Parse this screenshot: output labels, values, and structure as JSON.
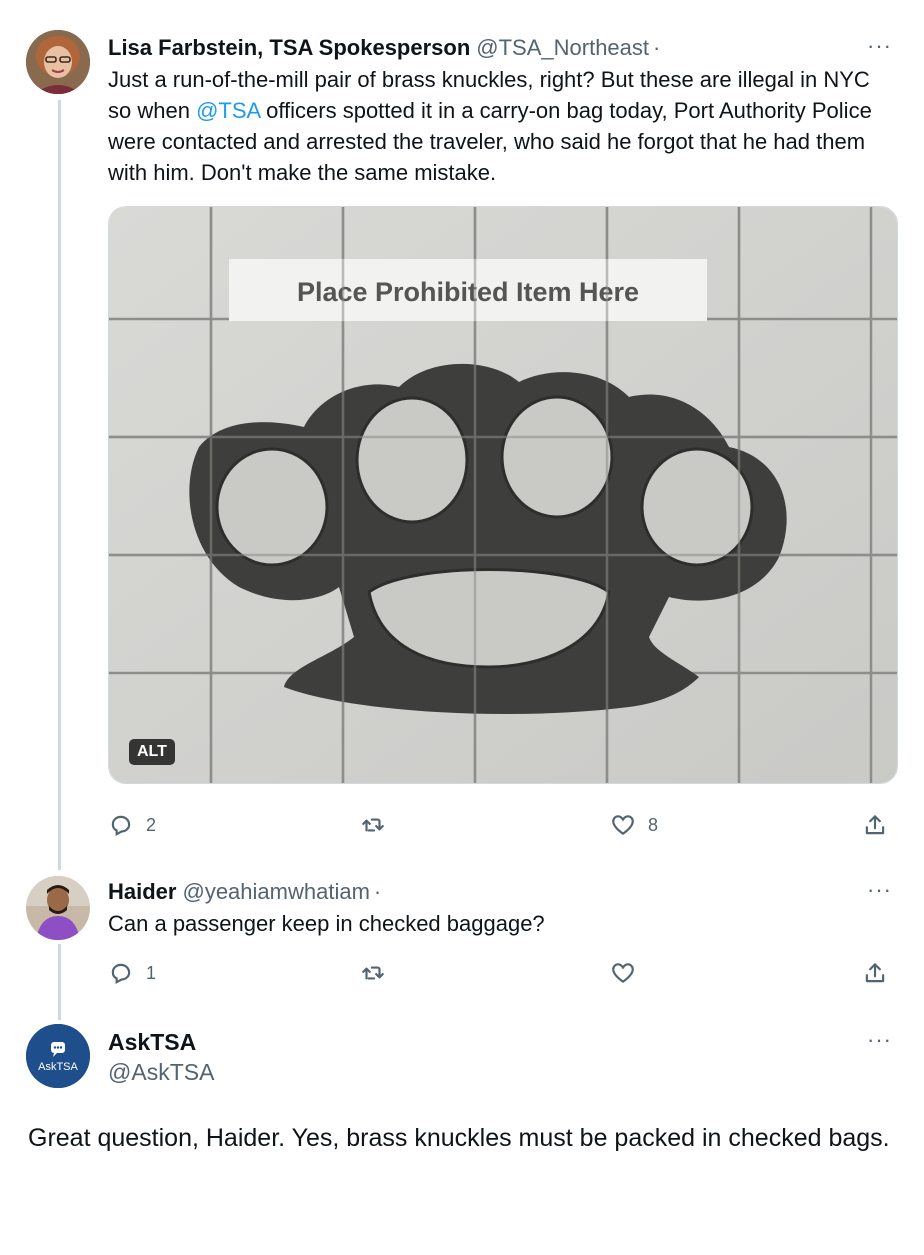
{
  "tweet1": {
    "name": "Lisa Farbstein, TSA Spokesperson",
    "handle": "@TSA_Northeast",
    "dot": "·",
    "text_before": "Just a run-of-the-mill pair of brass knuckles, right? But these are illegal in NYC so when ",
    "mention": "@TSA",
    "text_after": " officers spotted it in a carry-on bag today, Port Authority Police were contacted and arrested the traveler, who said he forgot that he had them with him. Don't make the same mistake.",
    "image_sign_text": "Place Prohibited Item Here",
    "alt_badge": "ALT",
    "replies": "2",
    "retweets": "",
    "likes": "8"
  },
  "tweet2": {
    "name": "Haider",
    "handle": "@yeahiamwhatiam",
    "dot": "·",
    "text": "Can a passenger keep in checked baggage?",
    "replies": "1",
    "retweets": "",
    "likes": ""
  },
  "tweet3": {
    "name": "AskTSA",
    "handle": "@AskTSA",
    "avatar_text": "AskTSA",
    "text": "Great question, Haider. Yes, brass knuckles must be packed in checked bags."
  },
  "more_glyph": "···",
  "colors": {
    "link": "#1d9bf0",
    "secondary_text": "#536471",
    "thread_line": "#cfd9de",
    "asktsa_avatar": "#1f4e8c"
  }
}
